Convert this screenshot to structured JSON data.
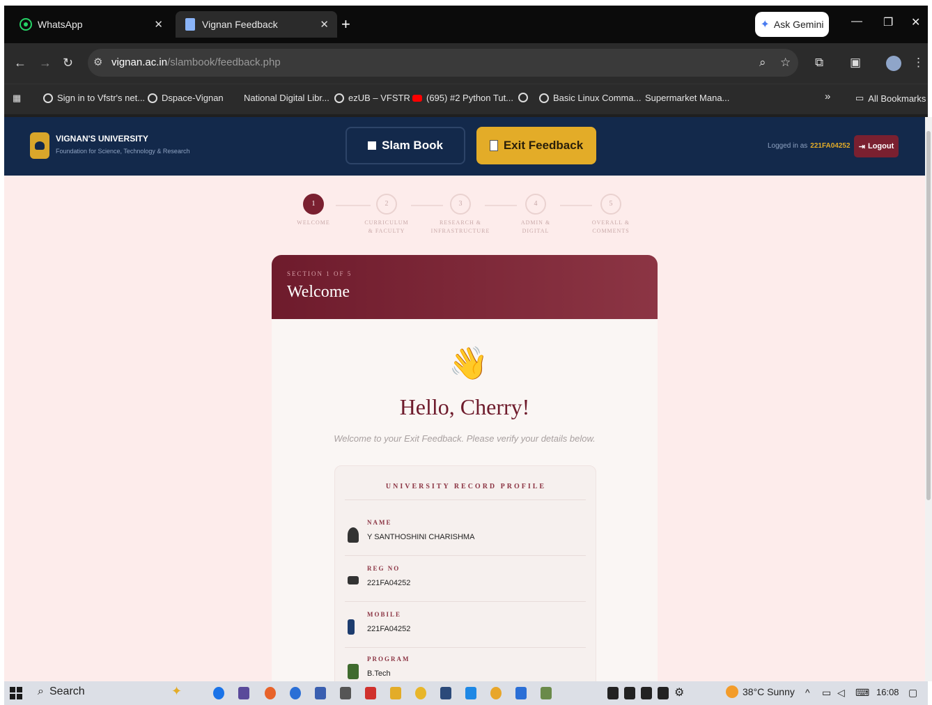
{
  "browser": {
    "tabs": [
      {
        "label": "WhatsApp",
        "icon": "whatsapp-icon"
      },
      {
        "label": "Vignan Feedback",
        "icon": "document-icon"
      }
    ],
    "ask_gemini": "Ask Gemini",
    "url_host": "vignan.ac.in",
    "url_path": "/slambook/feedback.php",
    "bookmarks": [
      "Sign in to Vfstr's net...",
      "Dspace-Vignan",
      "National Digital Libr...",
      "ezUB – VFSTR",
      "(695) #2 Python Tut...",
      "Basic Linux Comma...",
      "Supermarket Mana..."
    ],
    "more_bookmarks": "»",
    "all_bookmarks": "All Bookmarks"
  },
  "header": {
    "university": "VIGNAN'S UNIVERSITY",
    "tagline": "Foundation for Science, Technology & Research",
    "slam_book": "Slam Book",
    "exit_feedback": "Exit Feedback",
    "logged_in_label": "Logged in as",
    "user_id": "221FA04252",
    "logout": "Logout"
  },
  "steps": [
    {
      "num": "1",
      "line1": "WELCOME",
      "line2": "",
      "active": true
    },
    {
      "num": "2",
      "line1": "CURRICULUM",
      "line2": "& FACULTY",
      "active": false
    },
    {
      "num": "3",
      "line1": "RESEARCH &",
      "line2": "INFRASTRUCTURE",
      "active": false
    },
    {
      "num": "4",
      "line1": "ADMIN &",
      "line2": "DIGITAL",
      "active": false
    },
    {
      "num": "5",
      "line1": "OVERALL &",
      "line2": "COMMENTS",
      "active": false
    }
  ],
  "card": {
    "section": "SECTION 1 OF 5",
    "title": "Welcome",
    "greeting": "Hello, Cherry!",
    "subtitle": "Welcome to your Exit Feedback. Please verify your details below.",
    "profile_title": "UNIVERSITY RECORD PROFILE",
    "fields": [
      {
        "label": "NAME",
        "value": "Y SANTHOSHINI CHARISHMA",
        "icon": "person-icon"
      },
      {
        "label": "REG NO",
        "value": "221FA04252",
        "icon": "graduation-cap-icon"
      },
      {
        "label": "MOBILE",
        "value": "221FA04252",
        "icon": "phone-icon"
      },
      {
        "label": "PROGRAM",
        "value": "B.Tech",
        "icon": "book-icon"
      }
    ]
  },
  "taskbar": {
    "search": "Search",
    "weather": "38°C  Sunny",
    "time": "16:08"
  }
}
